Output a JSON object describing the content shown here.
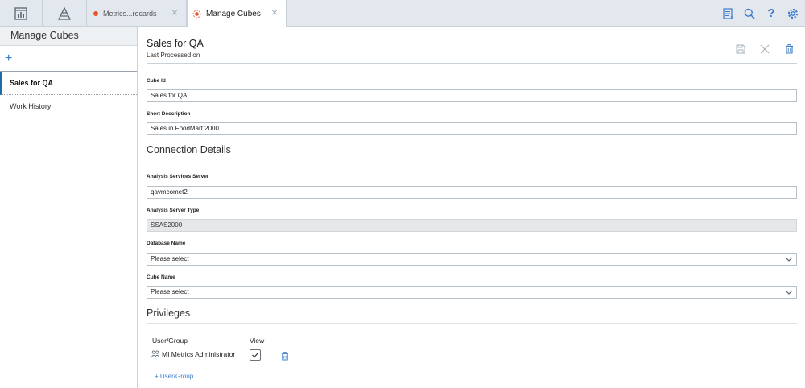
{
  "tabs": [
    {
      "label": "Metrics...recards",
      "close": "×"
    },
    {
      "label": "Manage Cubes",
      "close": "×"
    }
  ],
  "topbar_icons": [
    "report-icon",
    "search-icon",
    "help-icon",
    "settings-icon"
  ],
  "help_glyph": "?",
  "sidebar": {
    "title": "Manage Cubes",
    "add": "+",
    "items": [
      {
        "label": "Sales for QA",
        "active": true
      },
      {
        "label": "Work History",
        "active": false
      }
    ]
  },
  "main": {
    "title": "Sales for QA",
    "subtitle": "Last Processed on",
    "fields": {
      "cube_id": {
        "label": "Cube Id",
        "value": "Sales for QA"
      },
      "short_description": {
        "label": "Short Description",
        "value": "Sales in FoodMart 2000"
      },
      "connection_heading": "Connection Details",
      "analysis_server": {
        "label": "Analysis Services Server",
        "value": "qavmcomet2"
      },
      "server_type": {
        "label": "Analysis Server Type",
        "value": "SSAS2000"
      },
      "database_name": {
        "label": "Database Name",
        "value": "Please select"
      },
      "cube_name": {
        "label": "Cube Name",
        "value": "Please select"
      }
    },
    "privileges": {
      "heading": "Privileges",
      "col_user": "User/Group",
      "col_view": "View",
      "rows": [
        {
          "name": "MI Metrics Administrator",
          "view": true
        }
      ],
      "add_label": "+ User/Group"
    }
  },
  "colors": {
    "accent": "#3b7bc8",
    "tab_dot": "#e8542a",
    "active_bar": "#1d6ca8"
  }
}
